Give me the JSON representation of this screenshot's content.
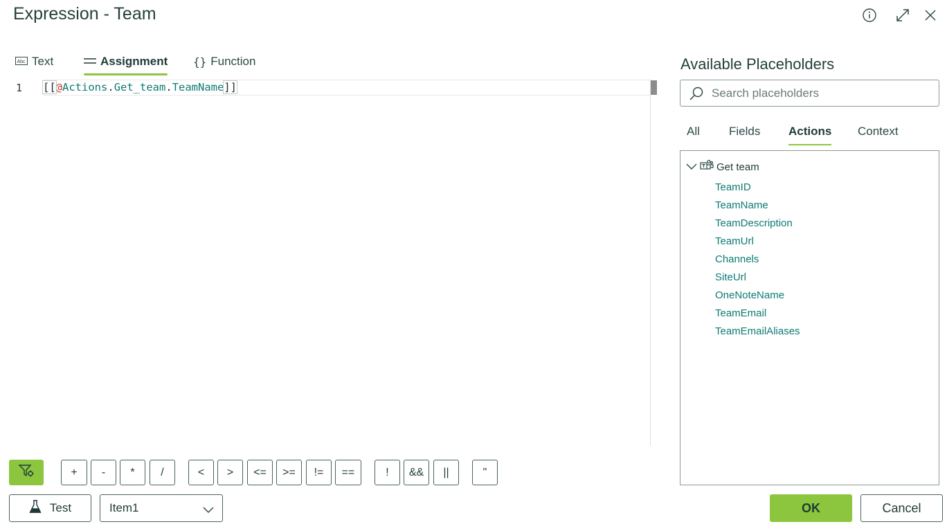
{
  "dialog": {
    "title": "Expression - Team"
  },
  "header_icons": {
    "info": "info-icon",
    "expand": "expand-icon",
    "close": "close-icon"
  },
  "tabs": [
    {
      "label": "Text",
      "icon": "abc-icon",
      "active": false
    },
    {
      "label": "Assignment",
      "icon": "equals-icon",
      "active": true
    },
    {
      "label": "Function",
      "icon": "braces-icon",
      "active": false
    }
  ],
  "editor": {
    "line_number": "1",
    "tokens": {
      "open": "[[",
      "at": "@",
      "actions": "Actions",
      "dot1": ".",
      "get_team": "Get_team",
      "dot2": ".",
      "team_name": "TeamName",
      "close": "]]"
    }
  },
  "operators": [
    "+",
    "-",
    "*",
    "/",
    "<",
    ">",
    "<=",
    ">=",
    "!=",
    "==",
    "!",
    "&&",
    "||",
    "\""
  ],
  "toolbar": {
    "test_label": "Test",
    "item_select": "Item1"
  },
  "placeholders": {
    "title": "Available Placeholders",
    "search_placeholder": "Search placeholders",
    "tabs": [
      {
        "label": "All",
        "active": false
      },
      {
        "label": "Fields",
        "active": false
      },
      {
        "label": "Actions",
        "active": true
      },
      {
        "label": "Context",
        "active": false
      }
    ],
    "group": {
      "label": "Get team",
      "icon": "teams-icon",
      "items": [
        "TeamID",
        "TeamName",
        "TeamDescription",
        "TeamUrl",
        "Channels",
        "SiteUrl",
        "OneNoteName",
        "TeamEmail",
        "TeamEmailAliases"
      ]
    }
  },
  "footer": {
    "ok_label": "OK",
    "cancel_label": "Cancel"
  },
  "colors": {
    "accent": "#8cc63f",
    "link": "#0e7a73",
    "text": "#1e3a36"
  }
}
